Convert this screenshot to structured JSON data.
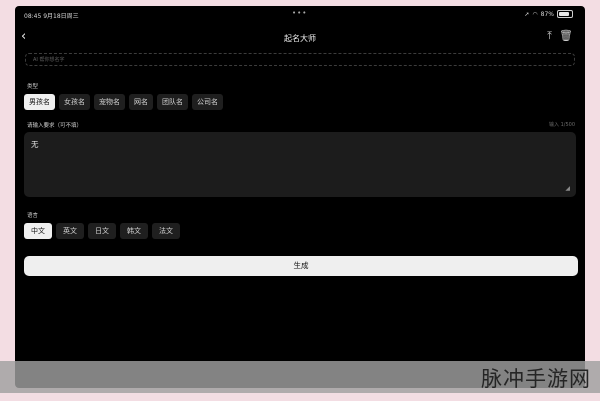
{
  "status_bar": {
    "time_date": "08:45 9月18日周三",
    "dots": "•••",
    "battery_percent": "87%",
    "battery_level": 0.87
  },
  "nav": {
    "back_icon": "chevron-left-icon",
    "title": "起名大师",
    "share_icon": "share-up-icon",
    "trash_icon": "trash-icon"
  },
  "ai_input": {
    "placeholder": "AI 帮你想名字"
  },
  "type_section": {
    "label": "类型",
    "options": [
      "男孩名",
      "女孩名",
      "宠物名",
      "网名",
      "团队名",
      "公司名"
    ],
    "selected": "男孩名"
  },
  "requirements": {
    "label": "请输入要求（可不填）",
    "counter": "输入 1/500",
    "value": "无"
  },
  "language_section": {
    "label": "语言",
    "options": [
      "中文",
      "英文",
      "日文",
      "韩文",
      "法文"
    ],
    "selected": "中文"
  },
  "generate": {
    "label": "生成"
  },
  "watermark": {
    "text": "脉冲手游网"
  },
  "colors": {
    "background": "#000000",
    "chip": "#1f1f1f",
    "chip_selected": "#f0f0f0",
    "button": "#efefef",
    "frame": "#f3dde3"
  }
}
